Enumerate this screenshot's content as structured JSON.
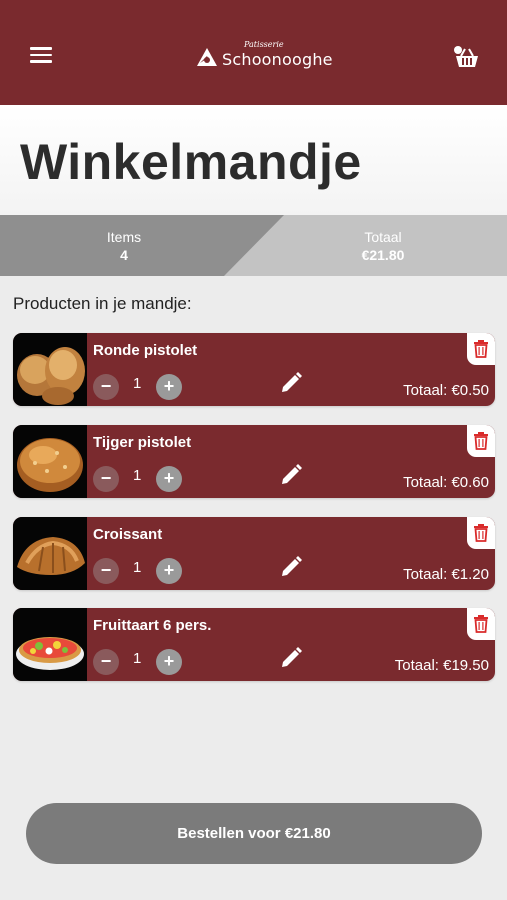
{
  "header": {
    "logo_sub": "Patisserie",
    "logo_main": "Schoonooghe",
    "menu_icon": "hamburger-menu-icon",
    "cart_icon": "basket-icon",
    "background": "#7a2a2e"
  },
  "page": {
    "title": "Winkelmandje"
  },
  "summary": {
    "items_label": "Items",
    "items_value": "4",
    "total_label": "Totaal",
    "total_value": "€21.80"
  },
  "section_label": "Producten in je mandje:",
  "products": [
    {
      "name": "Ronde pistolet",
      "qty": "1",
      "minus": "−",
      "plus": "+",
      "total": "Totaal: €0.50",
      "image": "round-bread-rolls"
    },
    {
      "name": "Tijger pistolet",
      "qty": "1",
      "minus": "−",
      "plus": "+",
      "total": "Totaal: €0.60",
      "image": "tiger-bread-roll"
    },
    {
      "name": "Croissant",
      "qty": "1",
      "minus": "−",
      "plus": "+",
      "total": "Totaal: €1.20",
      "image": "croissant"
    },
    {
      "name": "Fruittaart 6 pers.",
      "qty": "1",
      "minus": "−",
      "plus": "+",
      "total": "Totaal: €19.50",
      "image": "fruit-tart"
    }
  ],
  "order_button": {
    "label": "Bestellen voor €21.80"
  },
  "colors": {
    "accent": "#7a2a2e",
    "delete_icon": "#d92b2b",
    "button": "#7b7b7b"
  }
}
